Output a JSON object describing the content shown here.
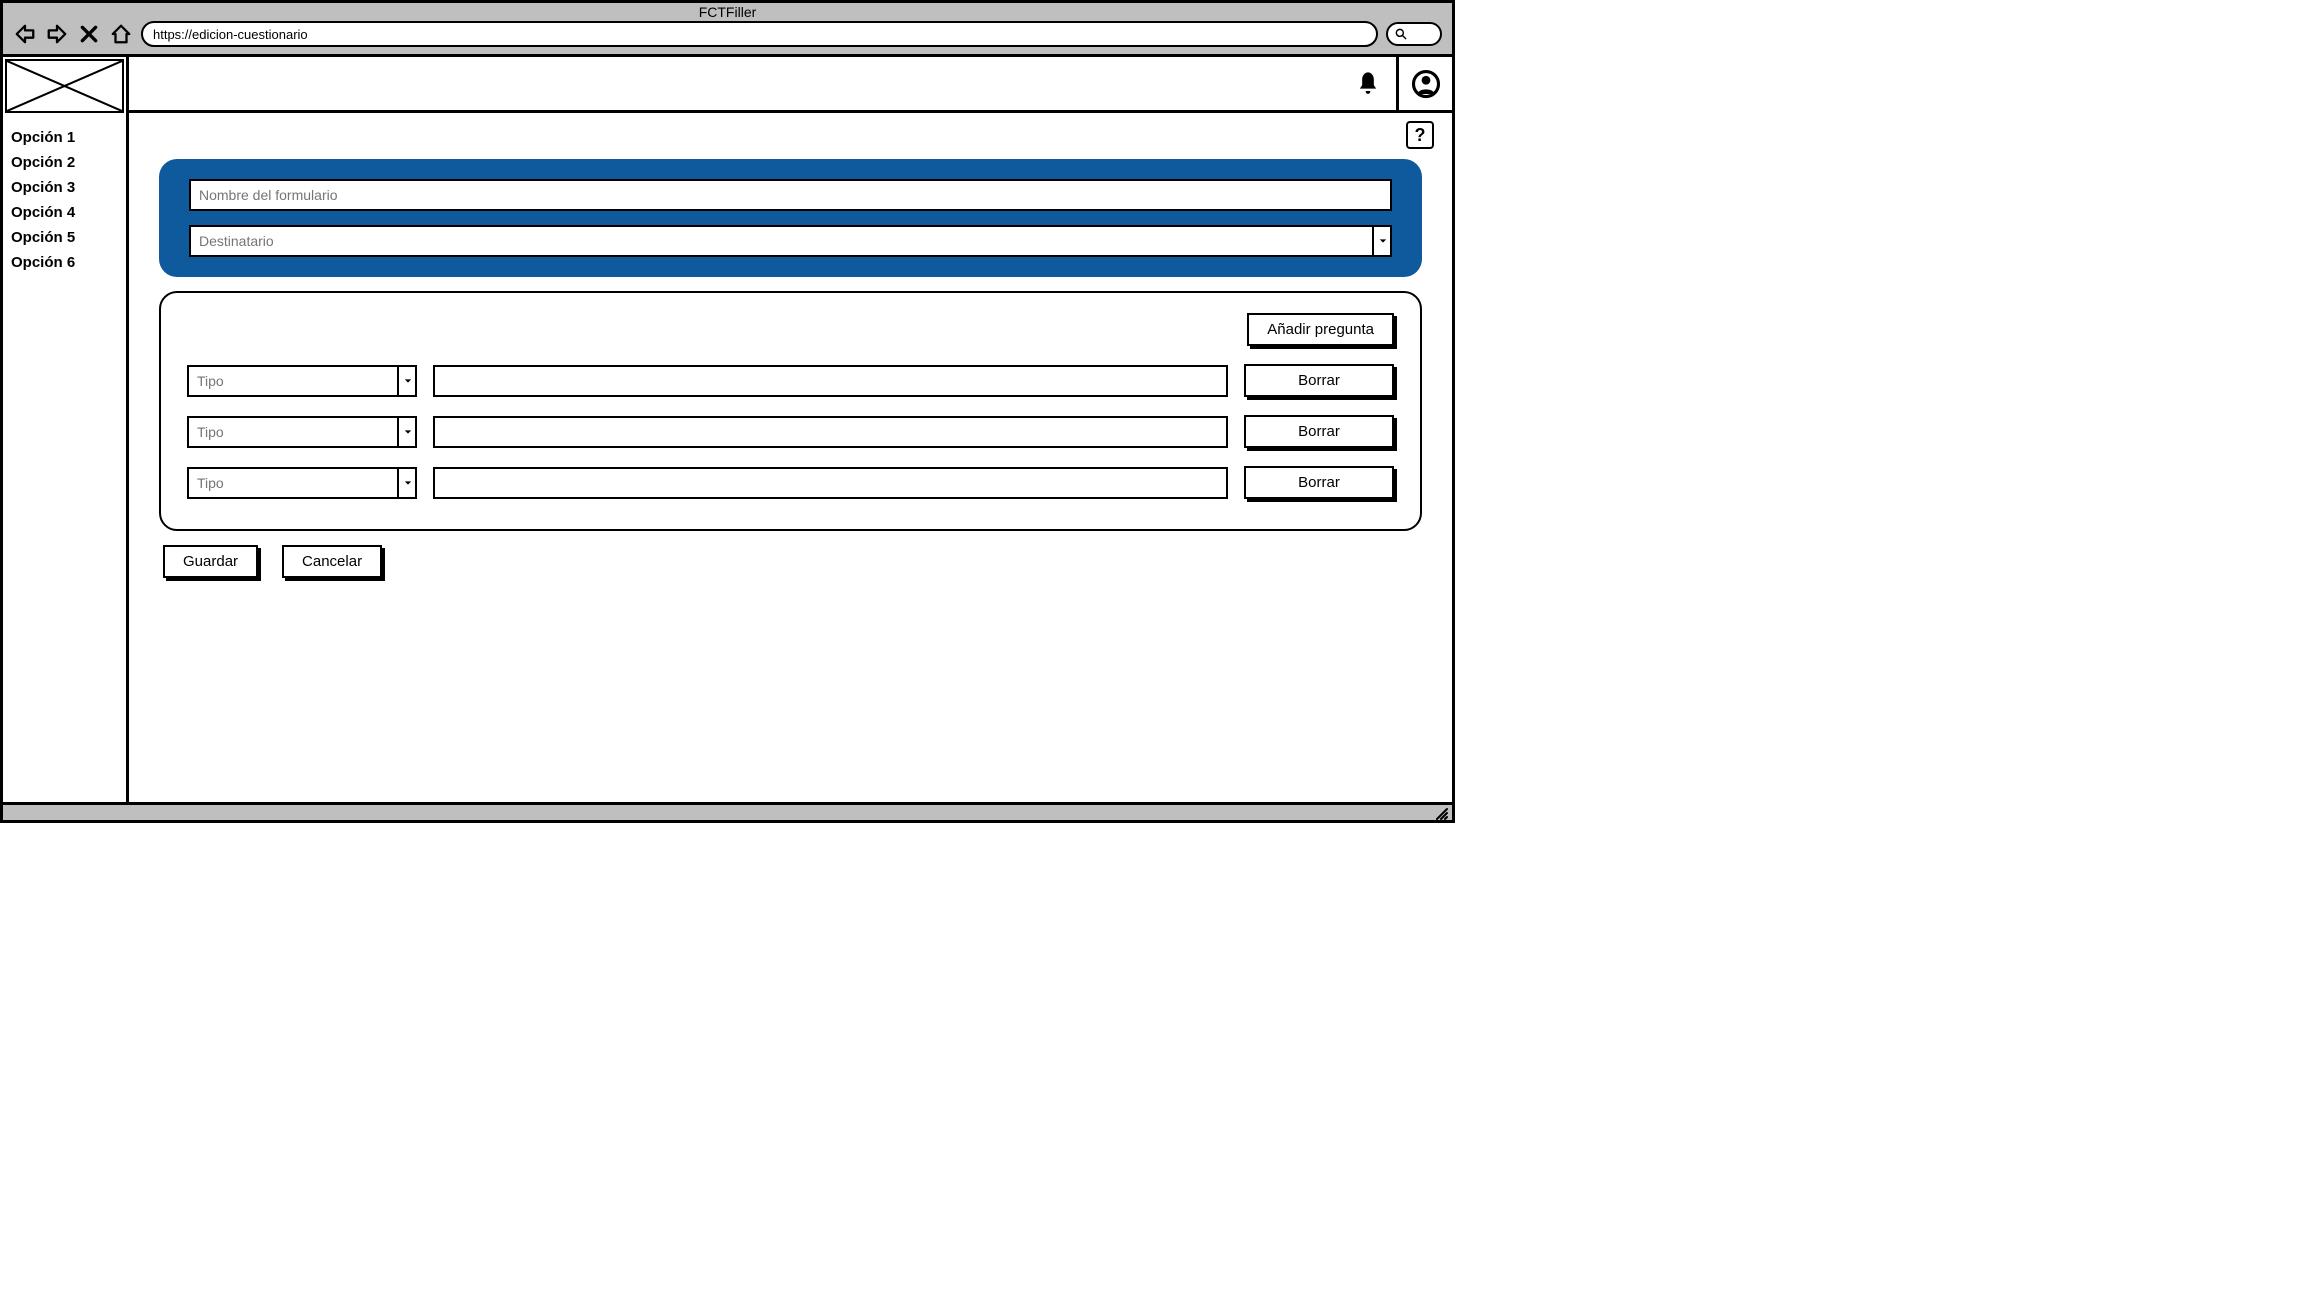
{
  "window": {
    "title": "FCTFiller",
    "url": "https://edicion-cuestionario"
  },
  "sidebar": {
    "items": [
      {
        "label": "Opción 1"
      },
      {
        "label": "Opción 2"
      },
      {
        "label": "Opción 3"
      },
      {
        "label": "Opción 4"
      },
      {
        "label": "Opción 5"
      },
      {
        "label": "Opción 6"
      }
    ]
  },
  "help": {
    "label": "?"
  },
  "form_header": {
    "name_placeholder": "Nombre del formulario",
    "recipient_placeholder": "Destinatario"
  },
  "questions": {
    "add_label": "Añadir pregunta",
    "rows": [
      {
        "type_placeholder": "Tipo",
        "delete_label": "Borrar"
      },
      {
        "type_placeholder": "Tipo",
        "delete_label": "Borrar"
      },
      {
        "type_placeholder": "Tipo",
        "delete_label": "Borrar"
      }
    ]
  },
  "actions": {
    "save_label": "Guardar",
    "cancel_label": "Cancelar"
  }
}
